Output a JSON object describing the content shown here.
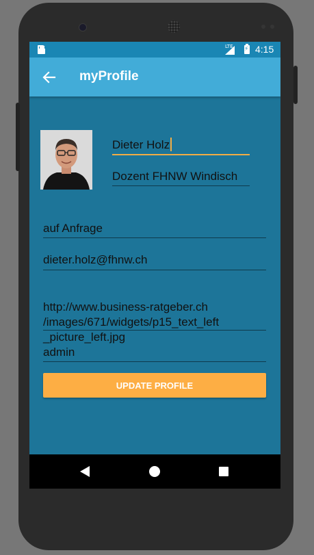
{
  "status_bar": {
    "network_label": "LTE",
    "time": "4:15"
  },
  "app_bar": {
    "title": "myProfile",
    "back_icon": "arrow-back-icon"
  },
  "profile": {
    "avatar_icon": "profile-photo",
    "name": "Dieter Holz",
    "position": "Dozent FHNW Windisch",
    "phone": "auf Anfrage",
    "email": "dieter.holz@fhnw.ch",
    "image_url": "http://www.business-ratgeber.ch\n/images/671/widgets/p15_text_left\n_picture_left.jpg",
    "role": "admin"
  },
  "actions": {
    "update_label": "UPDATE PROFILE"
  },
  "colors": {
    "primary": "#42acd8",
    "primary_dark": "#1a86b4",
    "background": "#1d7599",
    "accent": "#fdae44"
  },
  "nav_bar": {
    "back_icon": "triangle-back-icon",
    "home_icon": "circle-home-icon",
    "recents_icon": "square-recents-icon"
  }
}
